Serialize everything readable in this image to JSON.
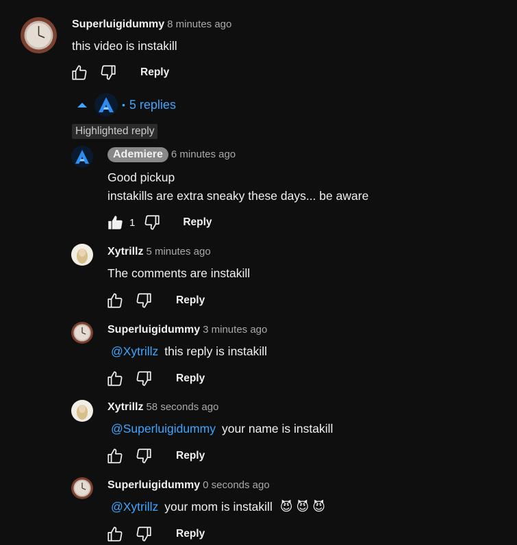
{
  "top_comment": {
    "author": "Superluigidummy",
    "time": "8 minutes ago",
    "text": "this video is instakill",
    "reply_label": "Reply"
  },
  "replies_toggle": {
    "count_label": "5 replies",
    "separator": "•"
  },
  "highlight_label": "Highlighted reply",
  "replies": [
    {
      "author": "Ademiere",
      "time": "6 minutes ago",
      "line1": "Good pickup",
      "line2": "instakills are extra sneaky these days... be aware",
      "likes": "1",
      "reply_label": "Reply"
    },
    {
      "author": "Xytrillz",
      "time": "5 minutes ago",
      "text": "The comments are instakill",
      "reply_label": "Reply"
    },
    {
      "author": "Superluigidummy",
      "time": "3 minutes ago",
      "mention": "@Xytrillz",
      "text": "this reply is instakill",
      "reply_label": "Reply"
    },
    {
      "author": "Xytrillz",
      "time": "58 seconds ago",
      "mention": "@Superluigidummy",
      "text": "your name is instakill",
      "reply_label": "Reply"
    },
    {
      "author": "Superluigidummy",
      "time": "0 seconds ago",
      "mention": "@Xytrillz",
      "text": "your mom is instakill",
      "emojis": "😈 😈 😈",
      "reply_label": "Reply"
    }
  ],
  "colors": {
    "background": "#0f0f0f",
    "link": "#3ea6ff",
    "muted": "#aaaaaa",
    "badge": "#888888"
  }
}
